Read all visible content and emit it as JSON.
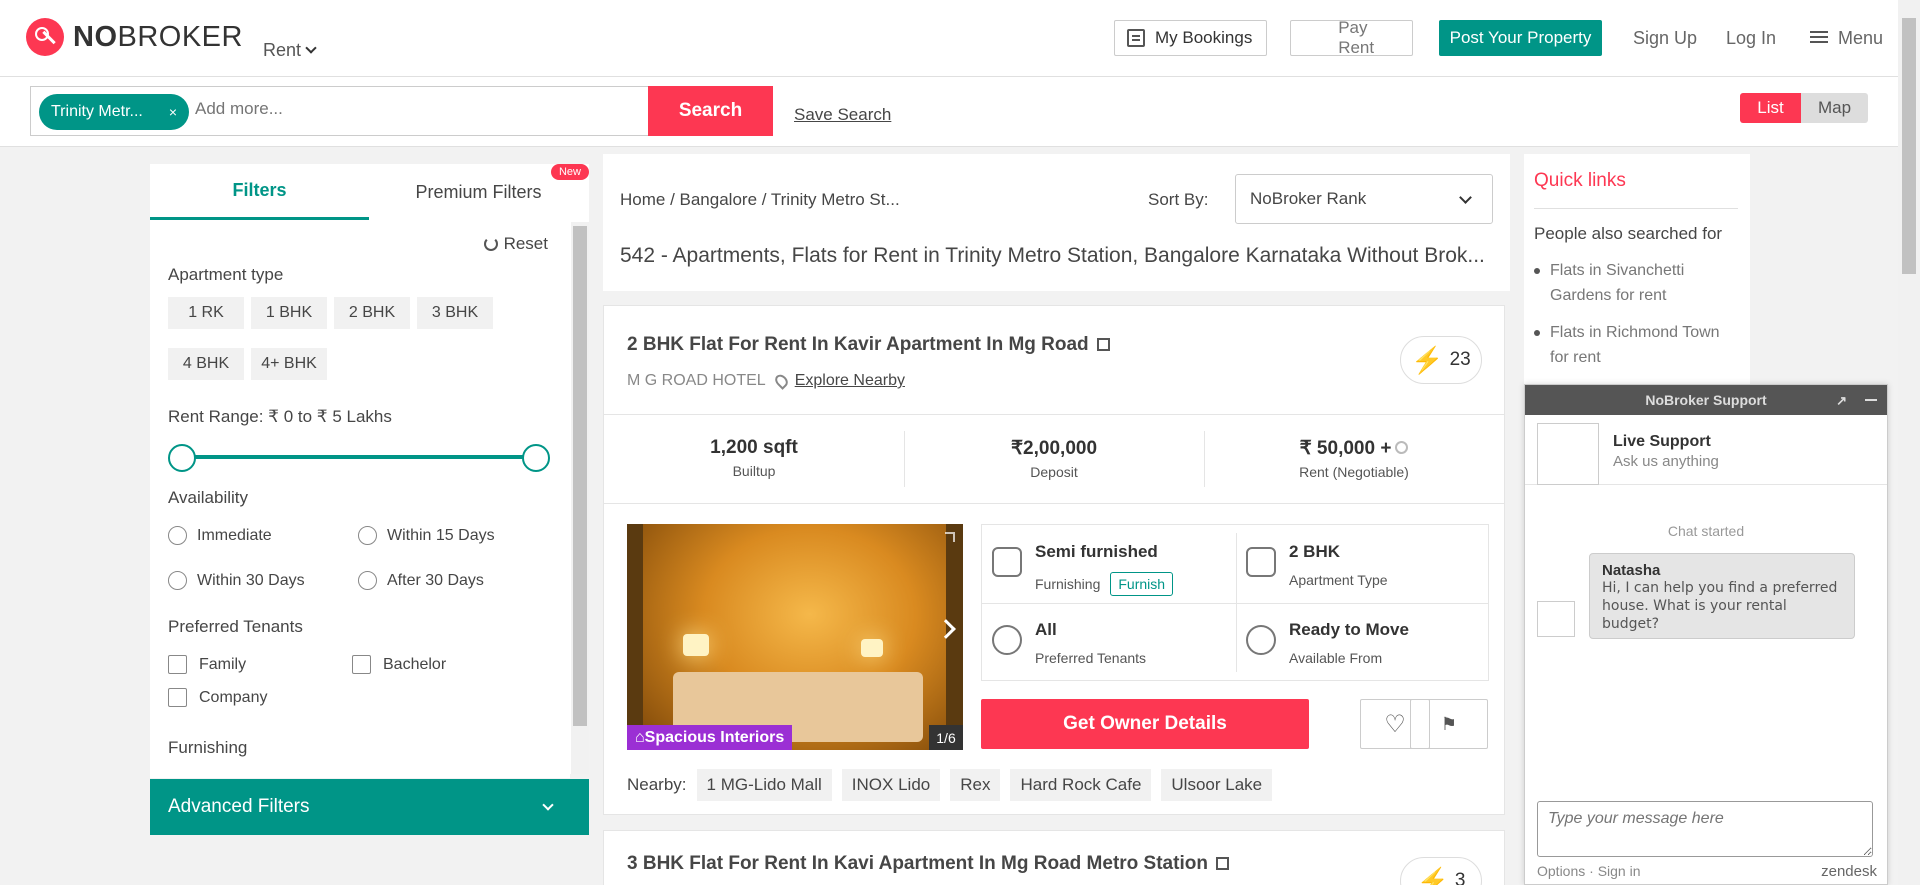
{
  "header": {
    "logo_bold": "NO",
    "logo_rest": "BROKER",
    "rent_dropdown": "Rent",
    "my_bookings": "My Bookings",
    "pay_rent": "Pay Rent",
    "post_property": "Post Your Property",
    "sign_up": "Sign Up",
    "log_in": "Log In",
    "menu": "Menu"
  },
  "search": {
    "chip": "Trinity Metr...",
    "chip_close": "×",
    "placeholder": "Add more...",
    "button": "Search",
    "save_search": "Save Search",
    "view_list": "List",
    "view_map": "Map"
  },
  "filters": {
    "tab_filters": "Filters",
    "tab_premium": "Premium Filters",
    "new_badge": "New",
    "reset": "Reset",
    "apartment_type_label": "Apartment type",
    "apartment_types": [
      "1 RK",
      "1 BHK",
      "2 BHK",
      "3 BHK",
      "4 BHK",
      "4+ BHK"
    ],
    "rent_range_label": "Rent Range: ₹ 0 to ₹ 5 Lakhs",
    "availability_label": "Availability",
    "availability": [
      "Immediate",
      "Within 15 Days",
      "Within 30 Days",
      "After 30 Days"
    ],
    "tenants_label": "Preferred Tenants",
    "tenants": [
      "Family",
      "Bachelor",
      "Company"
    ],
    "furnishing_label": "Furnishing",
    "advanced": "Advanced Filters"
  },
  "results": {
    "breadcrumb": "Home  / Bangalore / Trinity Metro St...",
    "sort_label": "Sort By:",
    "sort_value": "NoBroker Rank",
    "title": "542 - Apartments, Flats for Rent in Trinity Metro Station, Bangalore Karnataka Without Brok..."
  },
  "listing": {
    "title": "2 BHK Flat For Rent In Kavir Apartment In Mg Road",
    "location": "M G ROAD HOTEL",
    "explore": "Explore Nearby",
    "score": "23",
    "area_value": "1,200 sqft",
    "area_label": "Builtup",
    "deposit_value": "₹2,00,000",
    "deposit_label": "Deposit",
    "rent_value": "₹ 50,000 +",
    "rent_label": "Rent (Negotiable)",
    "photo_badge": "Spacious Interiors",
    "photo_count": "1/6",
    "furnishing_value": "Semi furnished",
    "furnishing_label": "Furnishing",
    "furnish_tag": "Furnish",
    "apt_type_value": "2 BHK",
    "apt_type_label": "Apartment Type",
    "tenants_value": "All",
    "tenants_label": "Preferred Tenants",
    "available_value": "Ready to Move",
    "available_label": "Available From",
    "owner_button": "Get Owner Details",
    "nearby_label": "Nearby:",
    "nearby": [
      "1 MG-Lido Mall",
      "INOX Lido",
      "Rex",
      "Hard Rock Cafe",
      "Ulsoor Lake"
    ]
  },
  "listing2": {
    "title": "3 BHK Flat For Rent In Kavi Apartment In Mg Road Metro Station",
    "score": "3"
  },
  "quick_links": {
    "title": "Quick links",
    "subtitle": "People also searched for",
    "items": [
      "Flats in Sivanchetti Gardens for rent",
      "Flats in Richmond Town for rent"
    ]
  },
  "chat": {
    "header": "NoBroker Support",
    "agent_name": "Live Support",
    "agent_sub": "Ask us anything",
    "started": "Chat started",
    "sender": "Natasha",
    "message": "Hi, I can help you find a preferred house. What is your rental budget?",
    "input_placeholder": "Type your message here",
    "footer": "Options  ·  Sign in",
    "brand": "zendesk"
  },
  "colors": {
    "brand_red": "#fd3752",
    "brand_teal": "#009587",
    "badge_purple": "#9b2fd4"
  }
}
